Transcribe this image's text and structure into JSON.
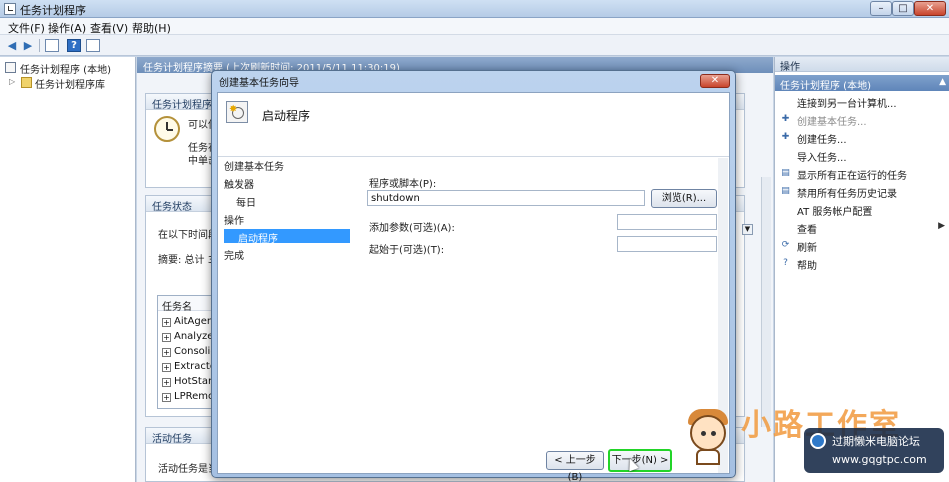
{
  "window": {
    "title": "任务计划程序",
    "buttons": {
      "minimize": "–",
      "maximize": "□",
      "close": "✕"
    }
  },
  "menu": [
    "文件(F)",
    "操作(A)",
    "查看(V)",
    "帮助(H)"
  ],
  "toolbar": {
    "back": "◀",
    "forward": "▶",
    "help": "?"
  },
  "tree": {
    "root": "任务计划程序 (本地)",
    "child": "任务计划程序库"
  },
  "center": {
    "header": "任务计划程序摘要 (上次刷新时间: 2011/5/11 11:30:19)",
    "overview_title": "任务计划程序概",
    "overview_line1": "可以使",
    "overview_line2": "任务存",
    "overview_line3": "中单击",
    "status_title": "任务状态",
    "status_line": "在以下时间段",
    "summary": "摘要: 总计 36",
    "task_list": {
      "header": "任务名",
      "rows": [
        "AitAgent",
        "AnalyzeS",
        "Consolid",
        "Extractor",
        "HotStart",
        "LPRemov"
      ]
    },
    "active_title": "活动任务",
    "active_line": "活动任务是当"
  },
  "actions": {
    "header": "操作",
    "sub": "任务计划程序 (本地)",
    "items": [
      {
        "label": "连接到另一台计算机...",
        "icon": "",
        "dim": false
      },
      {
        "label": "创建基本任务...",
        "icon": "✚",
        "dim": true
      },
      {
        "label": "创建任务...",
        "icon": "✚",
        "dim": false
      },
      {
        "label": "导入任务...",
        "icon": "",
        "dim": false
      },
      {
        "label": "显示所有正在运行的任务",
        "icon": "▤",
        "dim": false
      },
      {
        "label": "禁用所有任务历史记录",
        "icon": "▤",
        "dim": false
      },
      {
        "label": "AT 服务帐户配置",
        "icon": "",
        "dim": false
      },
      {
        "label": "查看",
        "icon": "",
        "dim": false,
        "arrow": "▶"
      },
      {
        "label": "刷新",
        "icon": "⟳",
        "dim": false
      },
      {
        "label": "帮助",
        "icon": "?",
        "dim": false
      }
    ]
  },
  "dialog": {
    "title": "创建基本任务向导",
    "close": "✕",
    "heading": "启动程序",
    "steps": {
      "create": "创建基本任务",
      "trigger": "触发器",
      "daily": "每日",
      "action": "操作",
      "start_program": "启动程序",
      "finish": "完成"
    },
    "form": {
      "program_label": "程序或脚本(P):",
      "program_value": "shutdown",
      "browse": "浏览(R)...",
      "args_label": "添加参数(可选)(A):",
      "args_value": "",
      "start_in_label": "起始于(可选)(T):",
      "start_in_value": ""
    },
    "buttons": {
      "back": "< 上一步(B)",
      "next": "下一步(N) >"
    }
  },
  "watermark": {
    "big_text": "小路工作室",
    "badge_line1": "过期懒米电脑论坛",
    "badge_line2": "www.gqgtpc.com"
  }
}
